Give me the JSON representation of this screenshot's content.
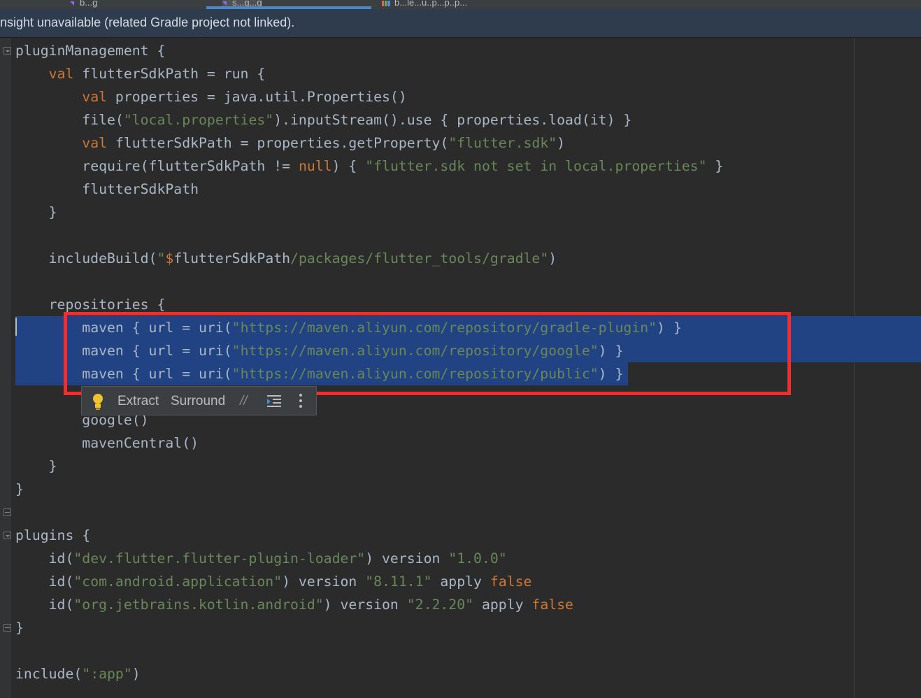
{
  "tabs": [
    {
      "label": "b...g"
    },
    {
      "label": "s...g...g"
    },
    {
      "label": "b...le...u..p...p..p..."
    }
  ],
  "banner": {
    "text": "nsight unavailable (related Gradle project not linked)."
  },
  "code": {
    "l1": {
      "a": "pluginManagement {"
    },
    "l2": {
      "indent": "    ",
      "kw": "val",
      "rest": " flutterSdkPath = run {"
    },
    "l3": {
      "indent": "        ",
      "kw": "val",
      "rest": " properties = java.util.Properties()"
    },
    "l4": {
      "indent": "        ",
      "a": "file(",
      "s1": "\"local.properties\"",
      "b": ").inputStream().use { properties.load(it) }"
    },
    "l5": {
      "indent": "        ",
      "kw": "val",
      "a": " flutterSdkPath = properties.getProperty(",
      "s1": "\"flutter.sdk\"",
      "b": ")"
    },
    "l6": {
      "indent": "        ",
      "a": "require(flutterSdkPath != ",
      "kw": "null",
      "b": ") { ",
      "s1": "\"flutter.sdk not set in local.properties\"",
      "c": " }"
    },
    "l7": {
      "indent": "        ",
      "a": "flutterSdkPath"
    },
    "l8": {
      "indent": "    ",
      "a": "}"
    },
    "l10": {
      "indent": "    ",
      "a": "includeBuild(",
      "q": "\"",
      "t": "$",
      "v": "flutterSdkPath",
      "s1": "/packages/flutter_tools/gradle\"",
      "b": ")"
    },
    "l12": {
      "indent": "    ",
      "a": "repositories {"
    },
    "l13": {
      "indent": "        ",
      "a": "maven { url = uri(",
      "s1": "\"https://maven.aliyun.com/repository/gradle-plugin\"",
      "b": ") }"
    },
    "l14": {
      "indent": "        ",
      "a": "maven { url = uri(",
      "s1": "\"https://maven.aliyun.com/repository/google\"",
      "b": ") }"
    },
    "l15": {
      "indent": "        ",
      "a": "maven { url = uri(",
      "s1": "\"https://maven.aliyun.com/repository/public\"",
      "b": ") }"
    },
    "l16": {
      "indent": "        ",
      "a": "google()"
    },
    "l17": {
      "indent": "        ",
      "a": "mavenCentral()"
    },
    "l18": {
      "indent": "    ",
      "a": "}"
    },
    "l19": {
      "a": "}"
    },
    "l21": {
      "a": "plugins {"
    },
    "l22": {
      "indent": "    ",
      "a": "id(",
      "s1": "\"dev.flutter.flutter-plugin-loader\"",
      "b": ") version ",
      "s2": "\"1.0.0\""
    },
    "l23": {
      "indent": "    ",
      "a": "id(",
      "s1": "\"com.android.application\"",
      "b": ") version ",
      "s2": "\"8.11.1\"",
      "c": " apply ",
      "kw": "false"
    },
    "l24": {
      "indent": "    ",
      "a": "id(",
      "s1": "\"org.jetbrains.kotlin.android\"",
      "b": ") version ",
      "s2": "\"2.2.20\"",
      "c": " apply ",
      "kw": "false"
    },
    "l25": {
      "a": "}"
    },
    "l27": {
      "a": "include(",
      "s1": "\":app\"",
      "b": ")"
    }
  },
  "float_toolbar": {
    "extract_label": "Extract",
    "surround_label": "Surround",
    "comment_glyph": "//"
  },
  "colors": {
    "editor_bg": "#2b2b2b",
    "keyword": "#cc7832",
    "string": "#6a8759",
    "text": "#a9b7c6",
    "selection": "#214283",
    "annotation_red": "#ee2f2f"
  }
}
